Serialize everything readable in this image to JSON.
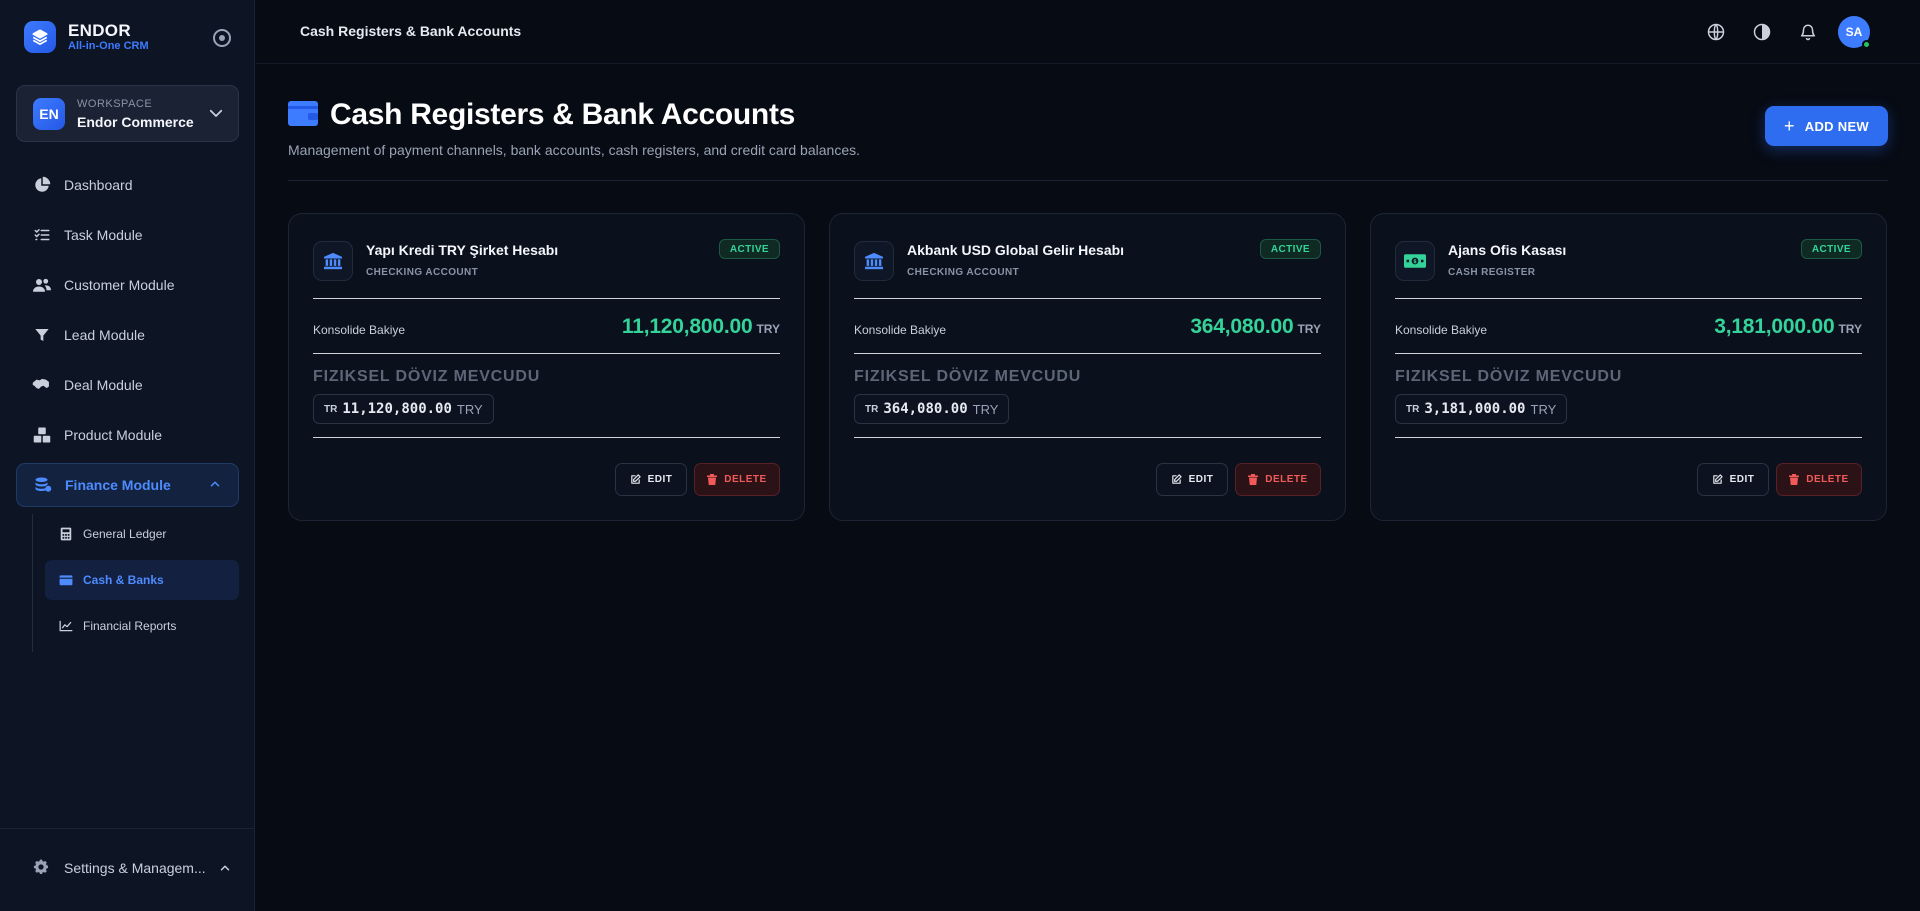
{
  "brand": {
    "name": "ENDOR",
    "subtitle": "All-in-One CRM"
  },
  "workspace": {
    "label": "WORKSPACE",
    "name": "Endor Commerce",
    "initials": "EN"
  },
  "nav": [
    {
      "label": "Dashboard",
      "icon": "pie-chart-icon"
    },
    {
      "label": "Task Module",
      "icon": "checklist-icon"
    },
    {
      "label": "Customer Module",
      "icon": "users-icon"
    },
    {
      "label": "Lead Module",
      "icon": "filter-icon"
    },
    {
      "label": "Deal Module",
      "icon": "handshake-icon"
    },
    {
      "label": "Product Module",
      "icon": "boxes-icon"
    },
    {
      "label": "Finance Module",
      "icon": "coins-icon",
      "active": true,
      "expanded": true
    }
  ],
  "finance_subnav": [
    {
      "label": "General Ledger",
      "icon": "calculator-icon"
    },
    {
      "label": "Cash & Banks",
      "icon": "wallet-icon",
      "active": true
    },
    {
      "label": "Financial Reports",
      "icon": "line-chart-icon"
    }
  ],
  "settings": {
    "label": "Settings & Managem..."
  },
  "topbar": {
    "title": "Cash Registers & Bank Accounts",
    "user_initials": "SA"
  },
  "page": {
    "title": "Cash Registers & Bank Accounts",
    "subtitle": "Management of payment channels, bank accounts, cash registers, and credit card balances.",
    "add_button": "ADD NEW"
  },
  "accounts": [
    {
      "name": "Yapı Kredi TRY Şirket Hesabı",
      "type": "CHECKING ACCOUNT",
      "icon": "bank-icon",
      "status": "ACTIVE",
      "balance_label": "Konsolide Bakiye",
      "balance": "11,120,800.00",
      "currency": "TRY",
      "fx_title": "FIZIKSEL DÖVIZ MEVCUDU",
      "fx_code": "TR",
      "fx_amount": "11,120,800.00",
      "fx_currency": "TRY",
      "edit_label": "EDIT",
      "delete_label": "DELETE"
    },
    {
      "name": "Akbank USD Global Gelir Hesabı",
      "type": "CHECKING ACCOUNT",
      "icon": "bank-icon",
      "status": "ACTIVE",
      "balance_label": "Konsolide Bakiye",
      "balance": "364,080.00",
      "currency": "TRY",
      "fx_title": "FIZIKSEL DÖVIZ MEVCUDU",
      "fx_code": "TR",
      "fx_amount": "364,080.00",
      "fx_currency": "TRY",
      "edit_label": "EDIT",
      "delete_label": "DELETE"
    },
    {
      "name": "Ajans Ofis Kasası",
      "type": "CASH REGISTER",
      "icon": "banknote-icon",
      "status": "ACTIVE",
      "balance_label": "Konsolide Bakiye",
      "balance": "3,181,000.00",
      "currency": "TRY",
      "fx_title": "FIZIKSEL DÖVIZ MEVCUDU",
      "fx_code": "TR",
      "fx_amount": "3,181,000.00",
      "fx_currency": "TRY",
      "edit_label": "EDIT",
      "delete_label": "DELETE"
    }
  ],
  "colors": {
    "accent": "#2e6cf0",
    "success": "#34d399",
    "danger": "#f25a5a",
    "background": "#070b14",
    "sidebar": "#0d1424"
  }
}
